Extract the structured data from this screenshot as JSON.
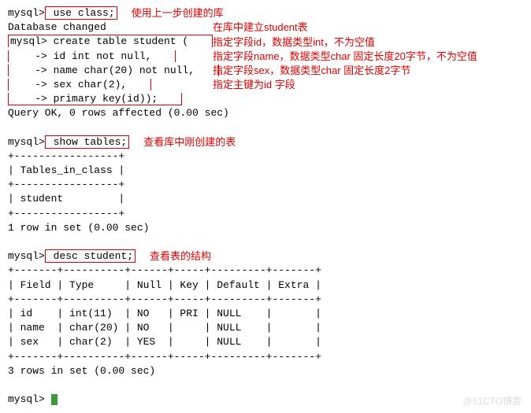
{
  "cmd1_prefix": "mysql>",
  "cmd1_body": " use class;",
  "anno1": "使用上一步创建的库",
  "resp1": "Database changed",
  "cmd2_l1a": "mysql> create table student (",
  "cmd2_l2": "    -> id int not null,",
  "cmd2_l3": "    -> name char(20) not null,",
  "cmd2_l4": "    -> sex char(2),",
  "cmd2_l5": "    -> primary key(id));",
  "anno2a": "在库中建立student表",
  "anno2b": "指定字段id，数据类型int，不为空值",
  "anno2c": "指定字段name，数据类型char 固定长度20字节，不为空值",
  "anno2d": "指定字段sex，数据类型char 固定长度2字节",
  "anno2e": "指定主键为id 字段",
  "resp2": "Query OK, 0 rows affected (0.00 sec)",
  "cmd3_prefix": "mysql>",
  "cmd3_body": " show tables;",
  "anno3": "查看库中刚创建的表",
  "tbl1_border": "+-----------------+",
  "tbl1_header": "| Tables_in_class |",
  "tbl1_row": "| student         |",
  "resp3": "1 row in set (0.00 sec)",
  "cmd4_prefix": "mysql>",
  "cmd4_body": " desc student;",
  "anno4": "查看表的结构",
  "tbl2_border": "+-------+----------+------+-----+---------+-------+",
  "tbl2_header": "| Field | Type     | Null | Key | Default | Extra |",
  "tbl2_r1": "| id    | int(11)  | NO   | PRI | NULL    |       |",
  "tbl2_r2": "| name  | char(20) | NO   |     | NULL    |       |",
  "tbl2_r3": "| sex   | char(2)  | YES  |     | NULL    |       |",
  "resp4": "3 rows in set (0.00 sec)",
  "final_prompt": "mysql> ",
  "watermark": "@51CTO博客",
  "chart_data": {
    "type": "table",
    "title": "desc student",
    "columns": [
      "Field",
      "Type",
      "Null",
      "Key",
      "Default",
      "Extra"
    ],
    "rows": [
      [
        "id",
        "int(11)",
        "NO",
        "PRI",
        "NULL",
        ""
      ],
      [
        "name",
        "char(20)",
        "NO",
        "",
        "NULL",
        ""
      ],
      [
        "sex",
        "char(2)",
        "YES",
        "",
        "NULL",
        ""
      ]
    ]
  }
}
